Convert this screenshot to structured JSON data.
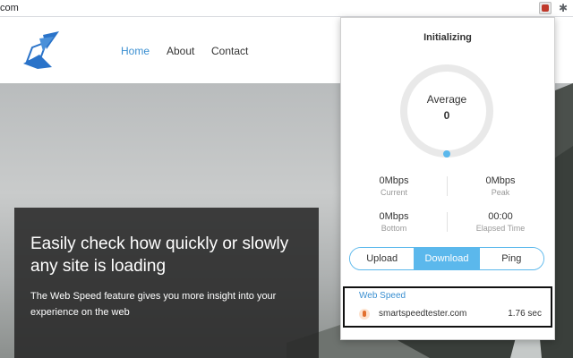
{
  "browser": {
    "url_fragment": "com",
    "puzzle_glyph": "✱"
  },
  "site": {
    "nav": [
      "Home",
      "About",
      "Contact"
    ],
    "hero_title": "Easily check how quickly or slowly any site is loading",
    "hero_text": "The Web Speed feature gives you more insight into your experience on the web"
  },
  "popup": {
    "title": "Initializing",
    "gauge_label": "Average",
    "gauge_value": "0",
    "gauge_progress": 0,
    "stats": [
      {
        "value": "0Mbps",
        "label": "Current"
      },
      {
        "value": "0Mbps",
        "label": "Peak"
      },
      {
        "value": "0Mbps",
        "label": "Bottom"
      },
      {
        "value": "00:00",
        "label": "Elapsed Time"
      }
    ],
    "modes": [
      "Upload",
      "Download",
      "Ping"
    ],
    "selected_mode": "Download",
    "history_title": "Web Speed",
    "history": [
      {
        "site": "smartspeedtester.com",
        "time": "1.76 sec"
      }
    ]
  },
  "colors": {
    "accent": "#5bb8ec",
    "link": "#3a8fd1"
  }
}
